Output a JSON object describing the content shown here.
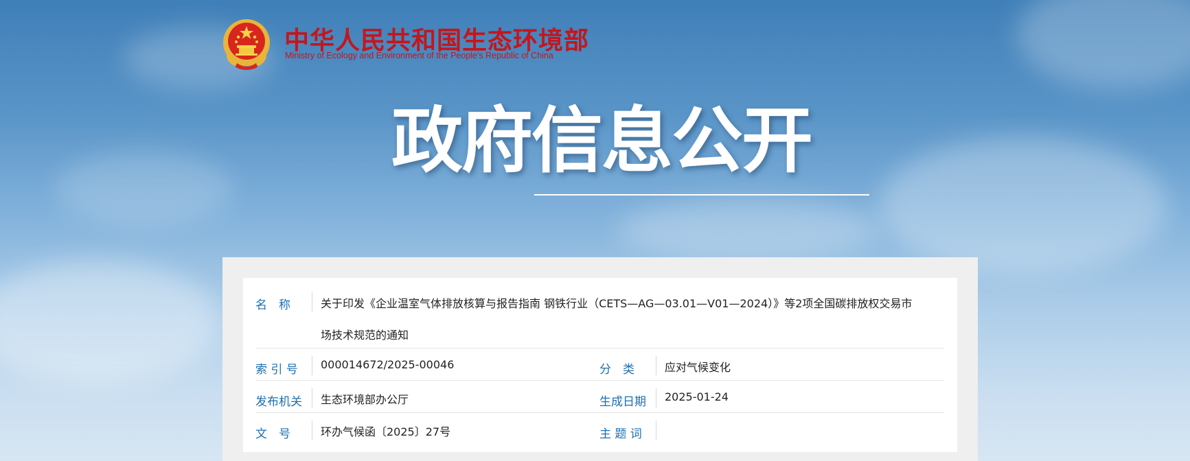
{
  "header": {
    "logo_cn": "中华人民共和国生态环境部",
    "logo_en": "Ministry of Ecology and Environment of the People's Republic of China",
    "title": "政府信息公开"
  },
  "info": {
    "name_label": "名　称",
    "name_line1": "关于印发《企业温室气体排放核算与报告指南 钢铁行业（CETS—AG—03.01—V01—2024）》等2项全国碳排放权交易市",
    "name_line2": "场技术规范的通知",
    "index_label": "索 引 号",
    "index_value": "000014672/2025-00046",
    "category_label": "分　类",
    "category_value": "应对气候变化",
    "org_label": "发布机关",
    "org_value": "生态环境部办公厅",
    "date_label": "生成日期",
    "date_value": "2025-01-24",
    "doc_label": "文　号",
    "doc_value": "环办气候函〔2025〕27号",
    "keyword_label": "主 题 词",
    "keyword_value": ""
  },
  "colors": {
    "brand_red": "#c4161c",
    "label_blue": "#1d6fb0"
  },
  "icons": {
    "emblem": "national-emblem-icon"
  }
}
